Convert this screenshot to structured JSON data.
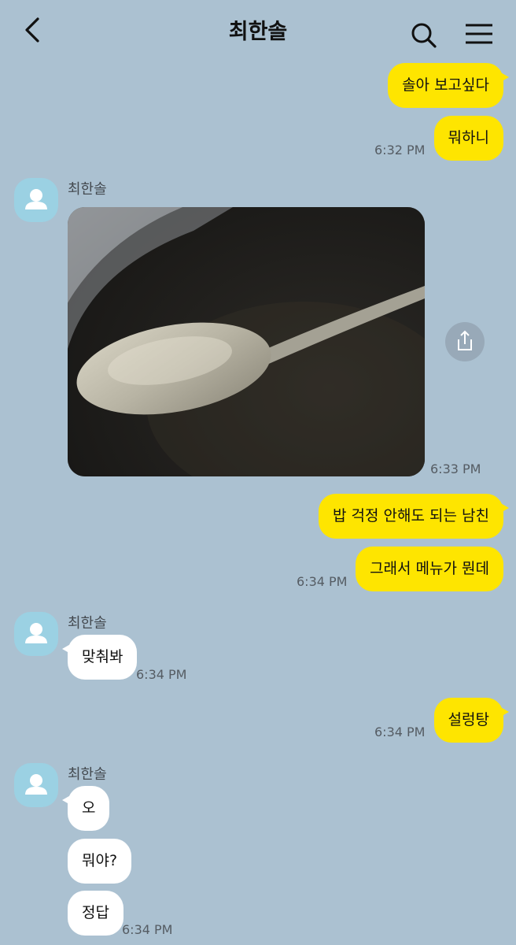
{
  "header": {
    "title": "최한솔",
    "back_icon": "chevron-left-icon",
    "search_icon": "search-icon",
    "menu_icon": "hamburger-menu-icon"
  },
  "colors": {
    "background": "#abc1d1",
    "my_bubble": "#fee500",
    "their_bubble": "#ffffff",
    "avatar": "#9bd1e3"
  },
  "messages": {
    "m1": "솔아 보고싶다",
    "m2": "뭐하니",
    "t1": "6:32 PM",
    "sender1": "최한솔",
    "t2": "6:33 PM",
    "m3": "밥 걱정 안해도 되는 남친",
    "m4": "그래서 메뉴가 뭔데",
    "t3": "6:34 PM",
    "sender2": "최한솔",
    "m5": "맞춰봐",
    "t4": "6:34 PM",
    "m6": "설렁탕",
    "t5": "6:34 PM",
    "sender3": "최한솔",
    "m7": "오",
    "m8": "뭐야?",
    "m9": "정답",
    "t6": "6:34 PM"
  }
}
